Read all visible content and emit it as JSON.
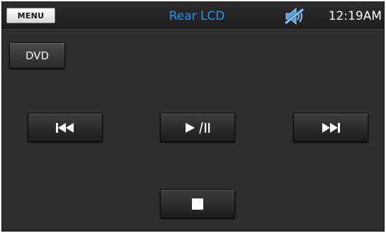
{
  "header": {
    "menu_label": "MENU",
    "title": "Rear LCD",
    "time": "12:19AM",
    "status_icon": "mute-speaker-icon",
    "title_color": "#1e96f0"
  },
  "source": {
    "label": "DVD"
  },
  "controls": {
    "previous_icon": "skip-previous-icon",
    "play_pause_icon": "play-pause-icon",
    "next_icon": "skip-next-icon",
    "stop_icon": "stop-icon"
  }
}
